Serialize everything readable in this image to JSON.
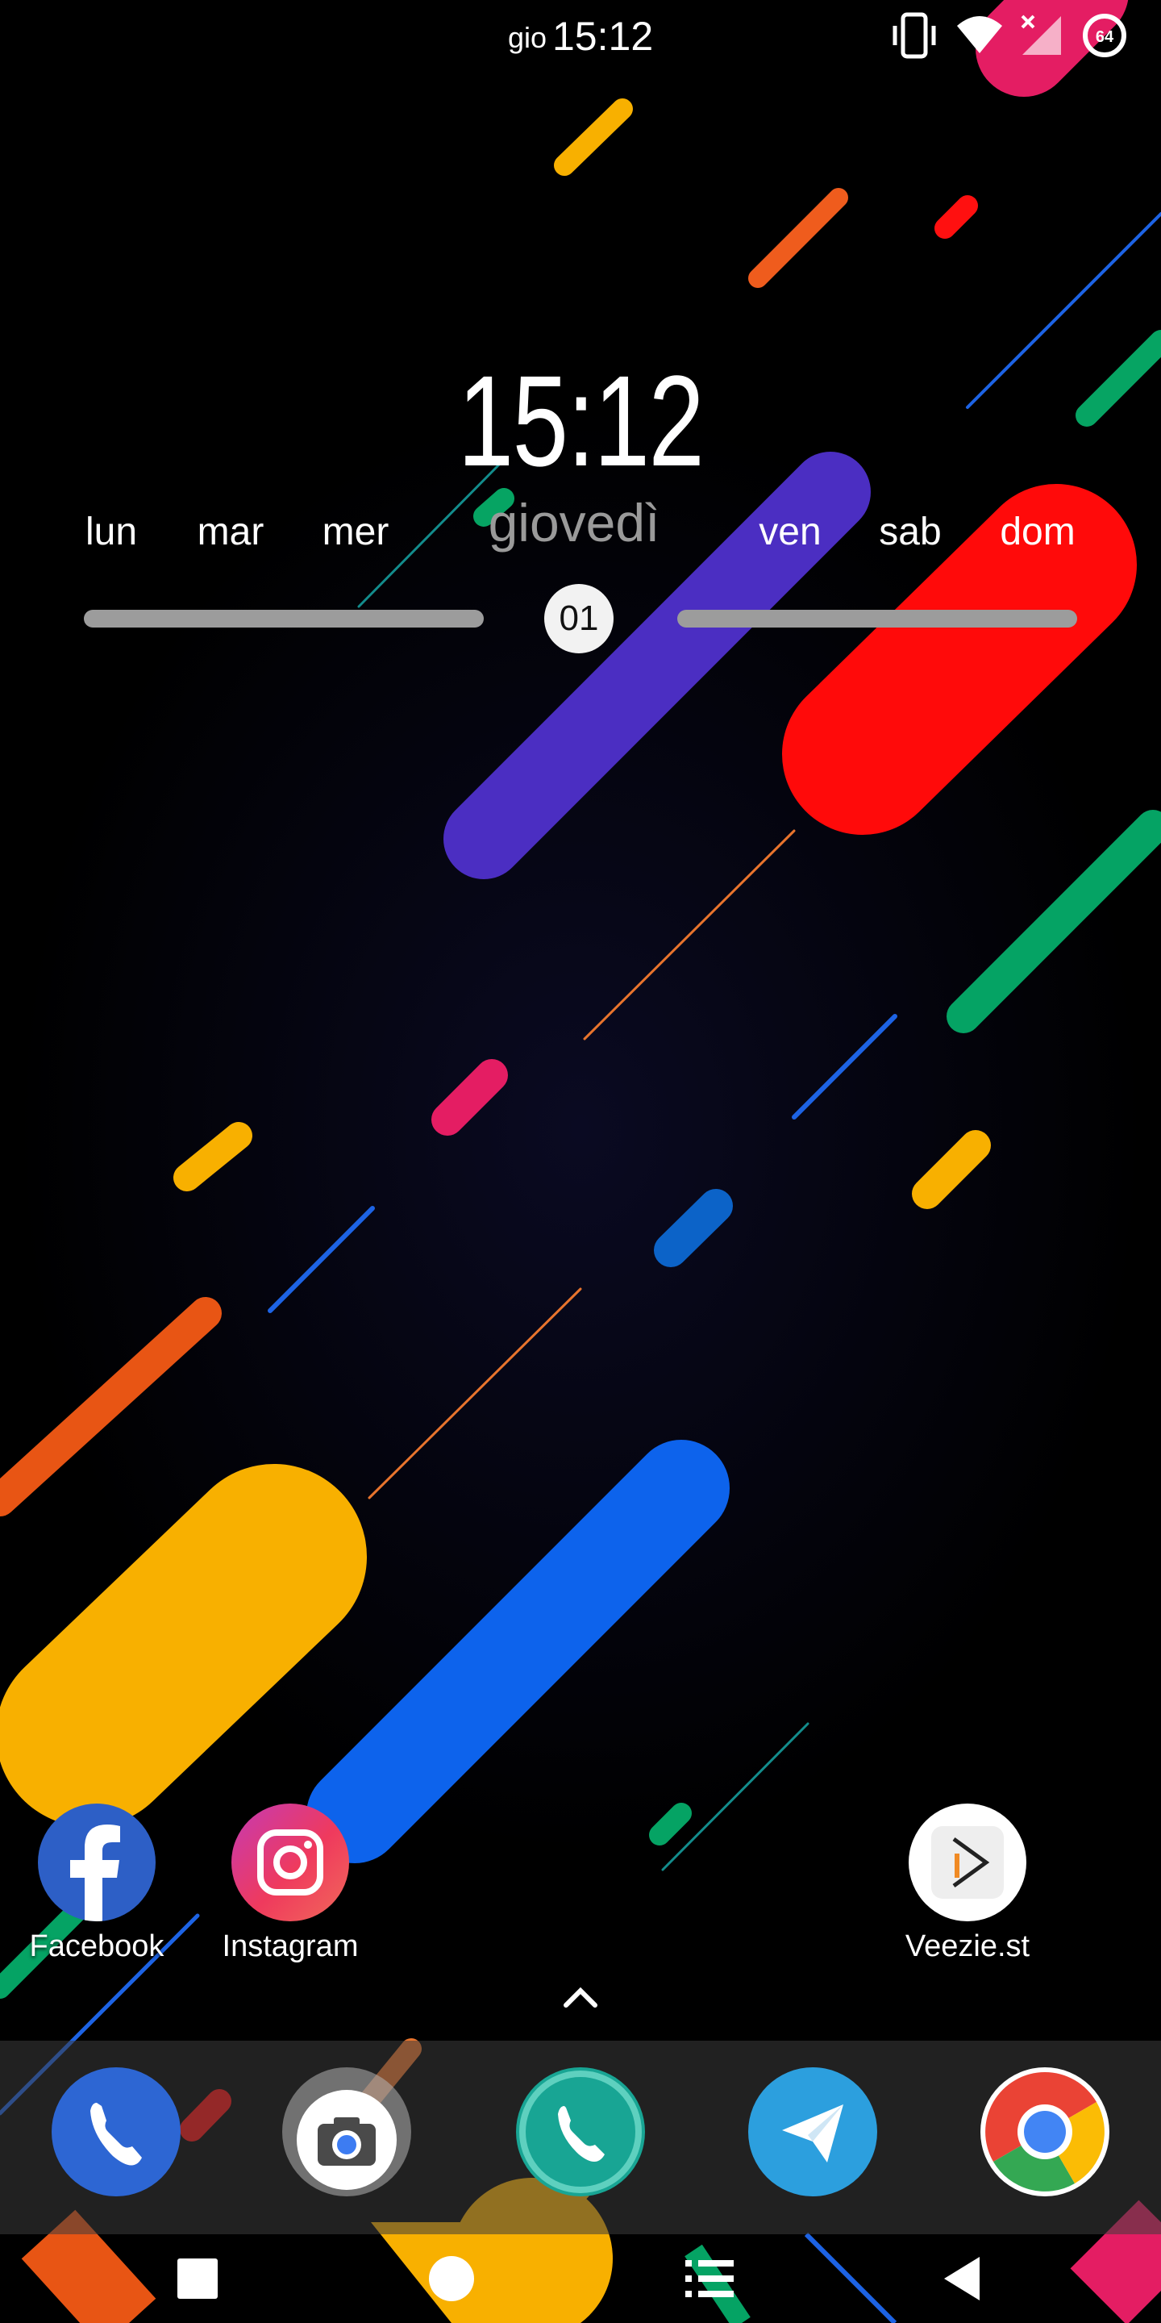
{
  "status_bar": {
    "day": "gio",
    "time": "15:12",
    "battery_level": "64"
  },
  "widget": {
    "time": "15:12",
    "days": [
      "lun",
      "mar",
      "mer",
      "giovedì",
      "ven",
      "sab",
      "dom"
    ],
    "today_index": 3,
    "date": "01"
  },
  "home_apps": [
    {
      "label": "Facebook",
      "icon": "facebook-icon"
    },
    {
      "label": "Instagram",
      "icon": "instagram-icon"
    },
    {
      "label": "Veezie.st",
      "icon": "veezie-icon"
    }
  ],
  "dock_apps": [
    {
      "icon": "phone-icon"
    },
    {
      "icon": "camera-icon"
    },
    {
      "icon": "whatsapp-icon"
    },
    {
      "icon": "telegram-icon"
    },
    {
      "icon": "chrome-icon"
    }
  ],
  "nav_buttons": [
    "recents-button",
    "home-button",
    "menu-button",
    "back-button"
  ],
  "colors": {
    "background": "#000000",
    "purple": "#4b2ec2",
    "red": "#ff0a0a",
    "yellow": "#f8b000",
    "blue": "#0d63ec",
    "green": "#05a364",
    "orange": "#e85514",
    "pink": "#e41d63"
  }
}
